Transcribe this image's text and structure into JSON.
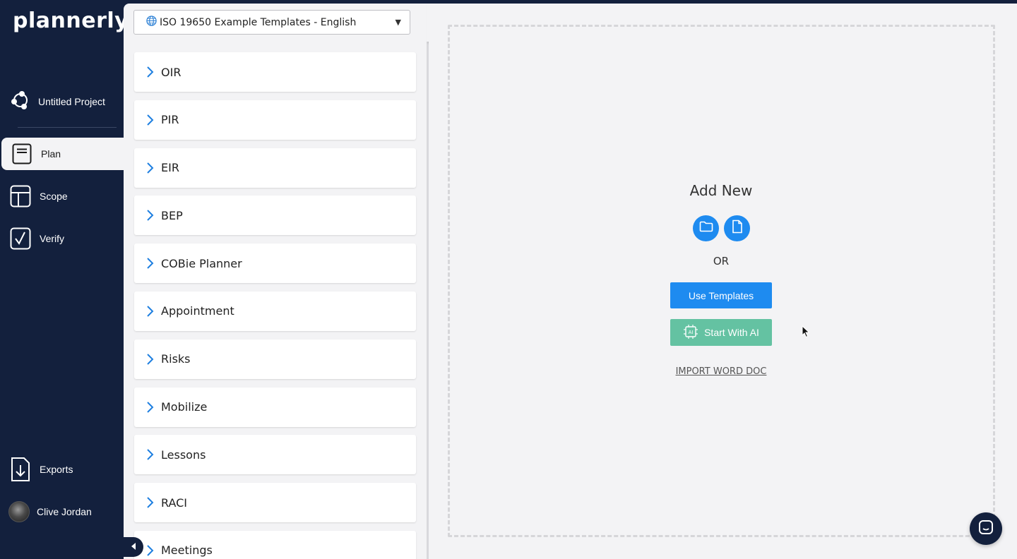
{
  "app": {
    "logo": "plannerly"
  },
  "sidebar": {
    "project_name": "Untitled Project",
    "nav": [
      {
        "label": "Plan",
        "icon": "document-icon",
        "active": true
      },
      {
        "label": "Scope",
        "icon": "layout-icon",
        "active": false
      },
      {
        "label": "Verify",
        "icon": "checkbox-icon",
        "active": false
      }
    ],
    "exports_label": "Exports",
    "user_name": "Clive Jordan"
  },
  "templates": {
    "selected": "ISO 19650 Example Templates - English",
    "items": [
      "OIR",
      "PIR",
      "EIR",
      "BEP",
      "COBie Planner",
      "Appointment",
      "Risks",
      "Mobilize",
      "Lessons",
      "RACI",
      "Meetings"
    ]
  },
  "main": {
    "add_new_title": "Add New",
    "or_label": "OR",
    "use_templates_label": "Use Templates",
    "start_ai_label": "Start With AI",
    "import_label": "IMPORT WORD DOC"
  },
  "colors": {
    "sidebar_bg": "#13203d",
    "primary": "#1e8bf0",
    "ai_button": "#64c2a2",
    "canvas_bg": "#f3f3f5"
  }
}
